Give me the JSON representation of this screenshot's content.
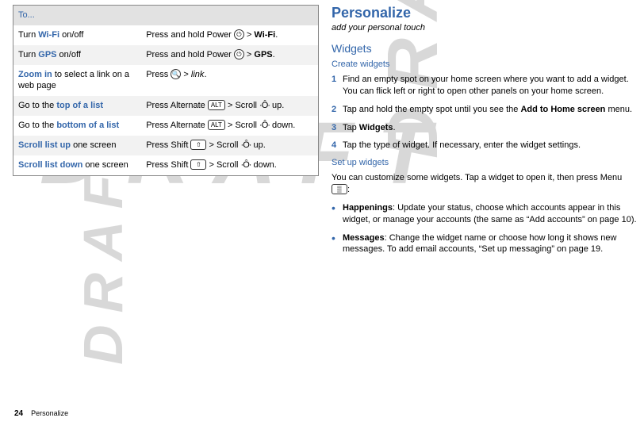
{
  "table": {
    "header": "To...",
    "rows": [
      {
        "a1": "Turn ",
        "a_hl": "Wi-Fi",
        "a2": " on/off",
        "b_pre": "Press and hold Power ",
        "b_key": "⏻",
        "b_key_circle": true,
        "b_post": " > ",
        "b_bold": "Wi-Fi",
        "b_tail": "."
      },
      {
        "a1": "Turn ",
        "a_hl": "GPS",
        "a2": " on/off",
        "b_pre": "Press and hold Power ",
        "b_key": "⏻",
        "b_key_circle": true,
        "b_post": " > ",
        "b_bold": "GPS",
        "b_tail": "."
      },
      {
        "a1": "",
        "a_hl": "Zoom in",
        "a2": " to select a link on a web page",
        "b_pre": "Press ",
        "b_key": "🔍",
        "b_key_circle": true,
        "b_post": " > ",
        "b_italic": "link",
        "b_tail": "."
      },
      {
        "a1": "Go to the ",
        "a_hl": "top of a list",
        "a2": "",
        "b_pre": "Press Alternate ",
        "b_key": "ALT",
        "b_key_circle": false,
        "b_post": " > Scroll ",
        "b_nav": "·Ô·",
        "b_tail": " up."
      },
      {
        "a1": "Go to the ",
        "a_hl": "bottom of a list",
        "a2": "",
        "b_pre": "Press Alternate ",
        "b_key": "ALT",
        "b_key_circle": false,
        "b_post": " > Scroll ",
        "b_nav": "·Ô·",
        "b_tail": " down."
      },
      {
        "a1": "",
        "a_hl": "Scroll list up",
        "a2": " one screen",
        "b_pre": "Press Shift ",
        "b_key": "⇧",
        "b_key_circle": false,
        "b_post": " > Scroll ",
        "b_nav": "·Ô·",
        "b_tail": " up."
      },
      {
        "a1": "",
        "a_hl": "Scroll list down",
        "a2": " one screen",
        "b_pre": "Press Shift ",
        "b_key": "⇧",
        "b_key_circle": false,
        "b_post": " > Scroll ",
        "b_nav": "·Ô·",
        "b_tail": " down."
      }
    ]
  },
  "right": {
    "title": "Personalize",
    "tagline": "add your personal touch",
    "widgets_h": "Widgets",
    "create_h": "Create widgets",
    "steps": [
      {
        "n": "1",
        "t": "Find an empty spot on your home screen where you want to add a widget. You can flick left or right to open other panels on your home screen."
      },
      {
        "n": "2",
        "t_pre": "Tap and hold the empty spot until you see the ",
        "t_bold": "Add to Home screen",
        "t_post": " menu."
      },
      {
        "n": "3",
        "t_pre": "Tap ",
        "t_bold": "Widgets",
        "t_post": "."
      },
      {
        "n": "4",
        "t": "Tap the type of widget. If necessary, enter the widget settings."
      }
    ],
    "setup_h": "Set up widgets",
    "setup_intro_pre": "You can customize some widgets. Tap a widget to open it, then press Menu ",
    "setup_intro_key": "▒",
    "setup_intro_post": ":",
    "bullets": [
      {
        "bold": "Happenings",
        "rest": ": Update your status, choose which accounts appear in this widget, or manage your accounts (the same as “Add accounts” on page 10)."
      },
      {
        "bold": "Messages",
        "rest": ": Change the widget name or choose how long it shows new messages. To add email accounts, “Set up messaging” on page 19."
      }
    ]
  },
  "footer": {
    "page": "24",
    "section": "Personalize"
  }
}
